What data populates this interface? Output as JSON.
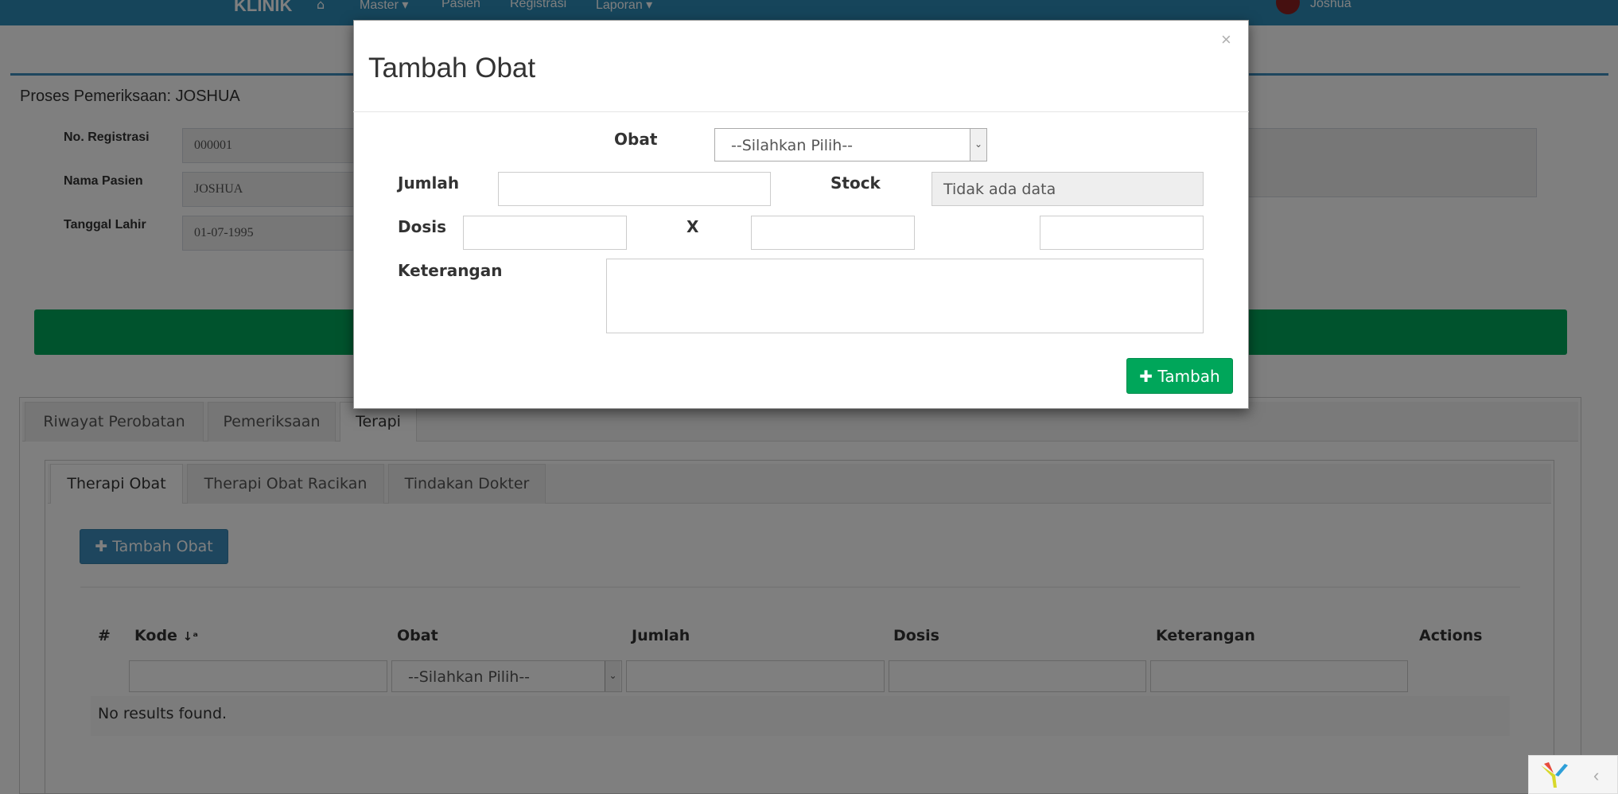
{
  "navbar": {
    "brand": "KLINIK",
    "home_icon": "home-icon",
    "items": [
      {
        "label": "Master ▾"
      },
      {
        "label": "Pasien"
      },
      {
        "label": "Registrasi"
      },
      {
        "label": "Laporan ▾"
      }
    ],
    "user": "Joshua"
  },
  "panel": {
    "title": "Proses Pemeriksaan: JOSHUA",
    "fields": [
      {
        "label": "No. Registrasi",
        "value": "000001"
      },
      {
        "label": "Nama Pasien",
        "value": "JOSHUA"
      },
      {
        "label": "Tanggal Lahir",
        "value": "01-07-1995"
      }
    ]
  },
  "tabs": [
    {
      "label": "Riwayat Perobatan",
      "active": false
    },
    {
      "label": "Pemeriksaan",
      "active": false
    },
    {
      "label": "Terapi",
      "active": true
    }
  ],
  "subtabs": [
    {
      "label": "Therapi Obat",
      "active": true
    },
    {
      "label": "Therapi Obat Racikan",
      "active": false
    },
    {
      "label": "Tindakan Dokter",
      "active": false
    }
  ],
  "therapy": {
    "add_button": "Tambah Obat",
    "add_icon": "plus-icon",
    "columns": [
      "#",
      "Kode",
      "Obat",
      "Jumlah",
      "Dosis",
      "Keterangan",
      "Actions"
    ],
    "sort_icon": "sort-alpha-icon",
    "filter_select": "--Silahkan Pilih--",
    "empty": "No results found."
  },
  "modal": {
    "title": "Tambah Obat",
    "close": "×",
    "obat_label": "Obat",
    "obat_select": "--Silahkan Pilih--",
    "jumlah_label": "Jumlah",
    "stock_label": "Stock",
    "stock_value": "Tidak ada data",
    "dosis_label": "Dosis",
    "x_label": "X",
    "keterangan_label": "Keterangan",
    "submit": "Tambah",
    "submit_icon": "plus-icon"
  },
  "colors": {
    "navbar": "#2c8bb7",
    "primary": "#3c8dbc",
    "success": "#00a65a"
  }
}
